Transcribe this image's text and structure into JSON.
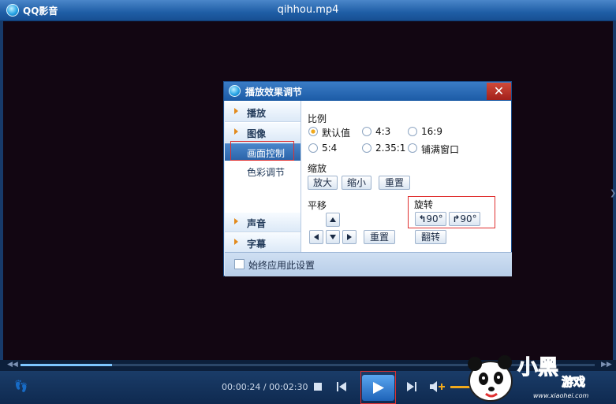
{
  "window": {
    "app_name": "QQ影音",
    "file_title": "qihhou.mp4"
  },
  "dialog": {
    "title": "播放效果调节",
    "close_glyph": "✕",
    "nav": {
      "playback": "播放",
      "image": "图像",
      "image_sub": [
        "画面控制",
        "色彩调节"
      ],
      "audio": "声音",
      "subtitle": "字幕"
    },
    "ratio": {
      "label": "比例",
      "options": [
        "默认值",
        "4:3",
        "16:9",
        "5:4",
        "2.35:1",
        "铺满窗口"
      ],
      "selected": "默认值"
    },
    "zoom": {
      "label": "缩放",
      "zoom_in": "放大",
      "zoom_out": "缩小",
      "reset": "重置"
    },
    "pan": {
      "label": "平移",
      "reset": "重置"
    },
    "rotate": {
      "label": "旋转",
      "left": "90°",
      "right": "90°",
      "flip": "翻转"
    },
    "footer": {
      "always_apply": "始终应用此设置"
    }
  },
  "player": {
    "time": "00:00:24 / 00:02:30",
    "progress": 0.16
  },
  "watermark": {
    "text1": "小黑",
    "text2": "游戏",
    "url": "www.xiaohei.com"
  },
  "colors": {
    "accent": "#f0a91c",
    "title_blue": "#1f5ea6",
    "highlight_red": "#e03030"
  }
}
